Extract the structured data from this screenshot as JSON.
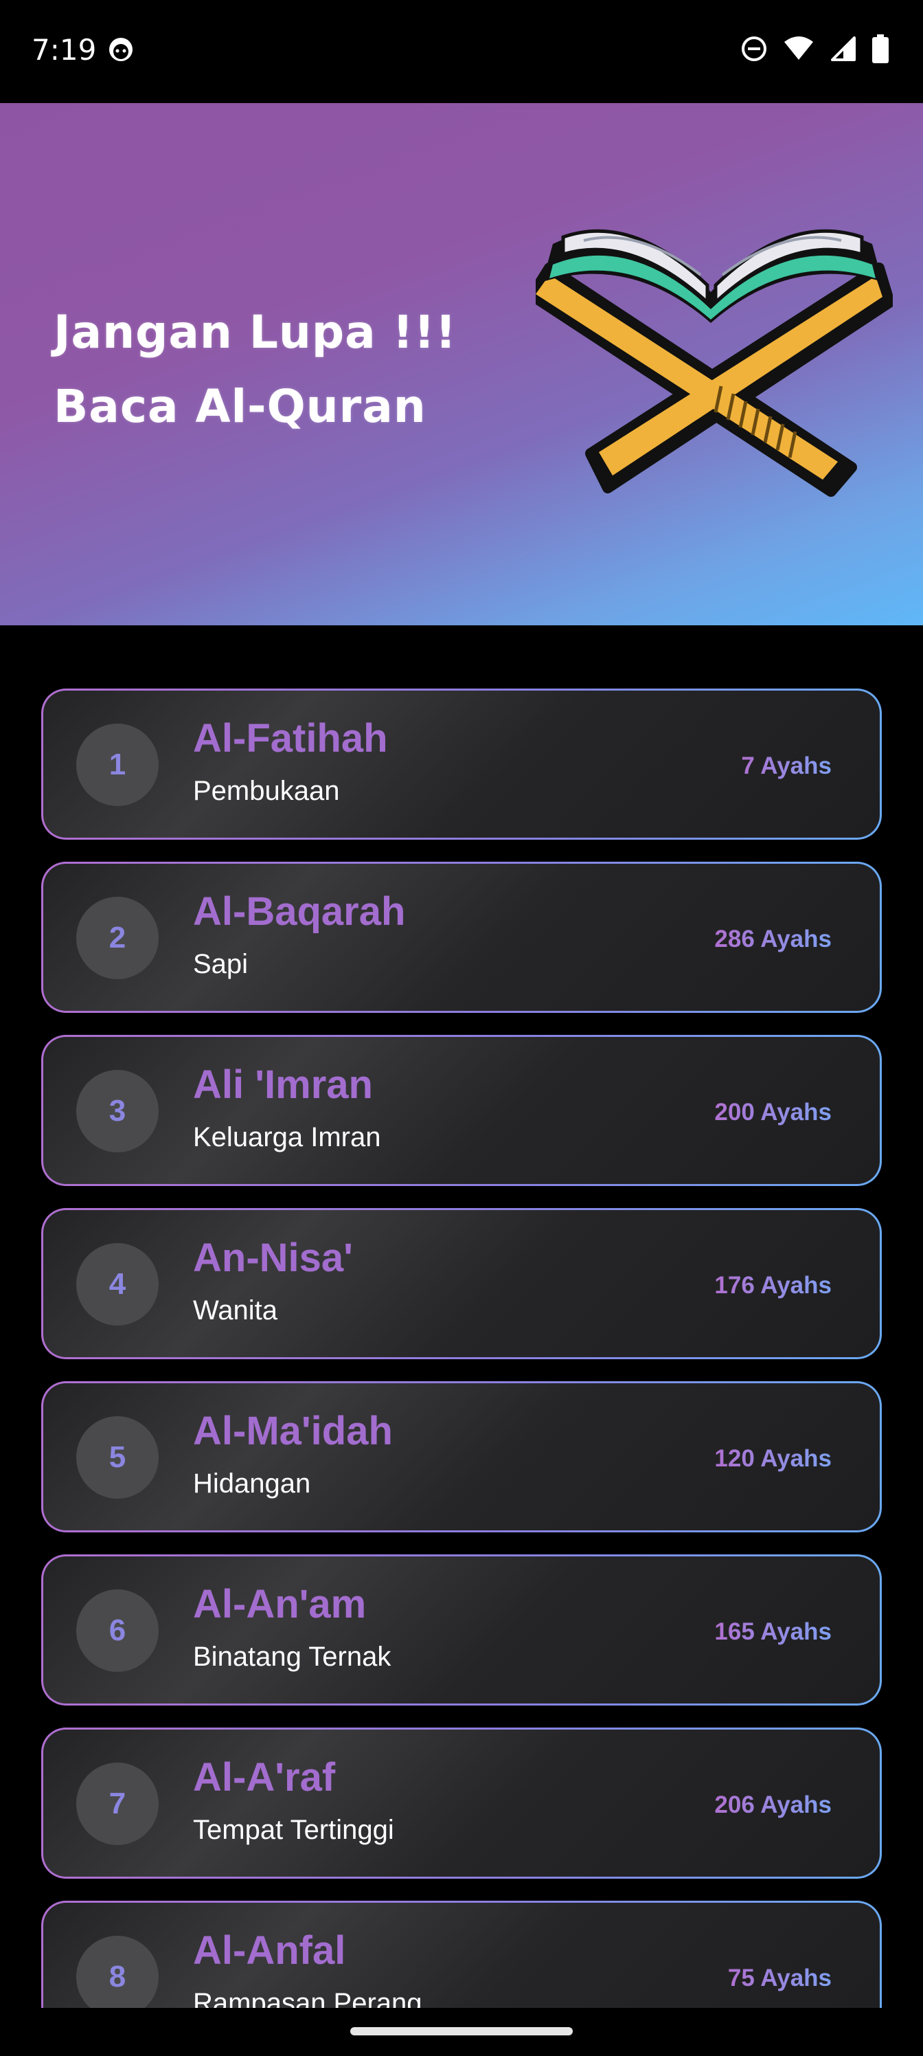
{
  "status_bar": {
    "time": "7:19"
  },
  "banner": {
    "line1": "Jangan Lupa !!!",
    "line2": "Baca Al-Quran"
  },
  "surahs": [
    {
      "number": "1",
      "name": "Al-Fatihah",
      "meaning": "Pembukaan",
      "ayahs": "7 Ayahs"
    },
    {
      "number": "2",
      "name": "Al-Baqarah",
      "meaning": "Sapi",
      "ayahs": "286 Ayahs"
    },
    {
      "number": "3",
      "name": "Ali 'Imran",
      "meaning": "Keluarga Imran",
      "ayahs": "200 Ayahs"
    },
    {
      "number": "4",
      "name": "An-Nisa'",
      "meaning": "Wanita",
      "ayahs": "176 Ayahs"
    },
    {
      "number": "5",
      "name": "Al-Ma'idah",
      "meaning": "Hidangan",
      "ayahs": "120 Ayahs"
    },
    {
      "number": "6",
      "name": "Al-An'am",
      "meaning": "Binatang Ternak",
      "ayahs": "165 Ayahs"
    },
    {
      "number": "7",
      "name": "Al-A'raf",
      "meaning": "Tempat Tertinggi",
      "ayahs": "206 Ayahs"
    },
    {
      "number": "8",
      "name": "Al-Anfal",
      "meaning": "Rampasan Perang",
      "ayahs": "75 Ayahs"
    }
  ],
  "colors": {
    "accent_purple": "#a36dcf",
    "accent_blue": "#6aa9f3",
    "card_bg": "#2a2a2c",
    "number_bg": "#4a4a4c"
  }
}
